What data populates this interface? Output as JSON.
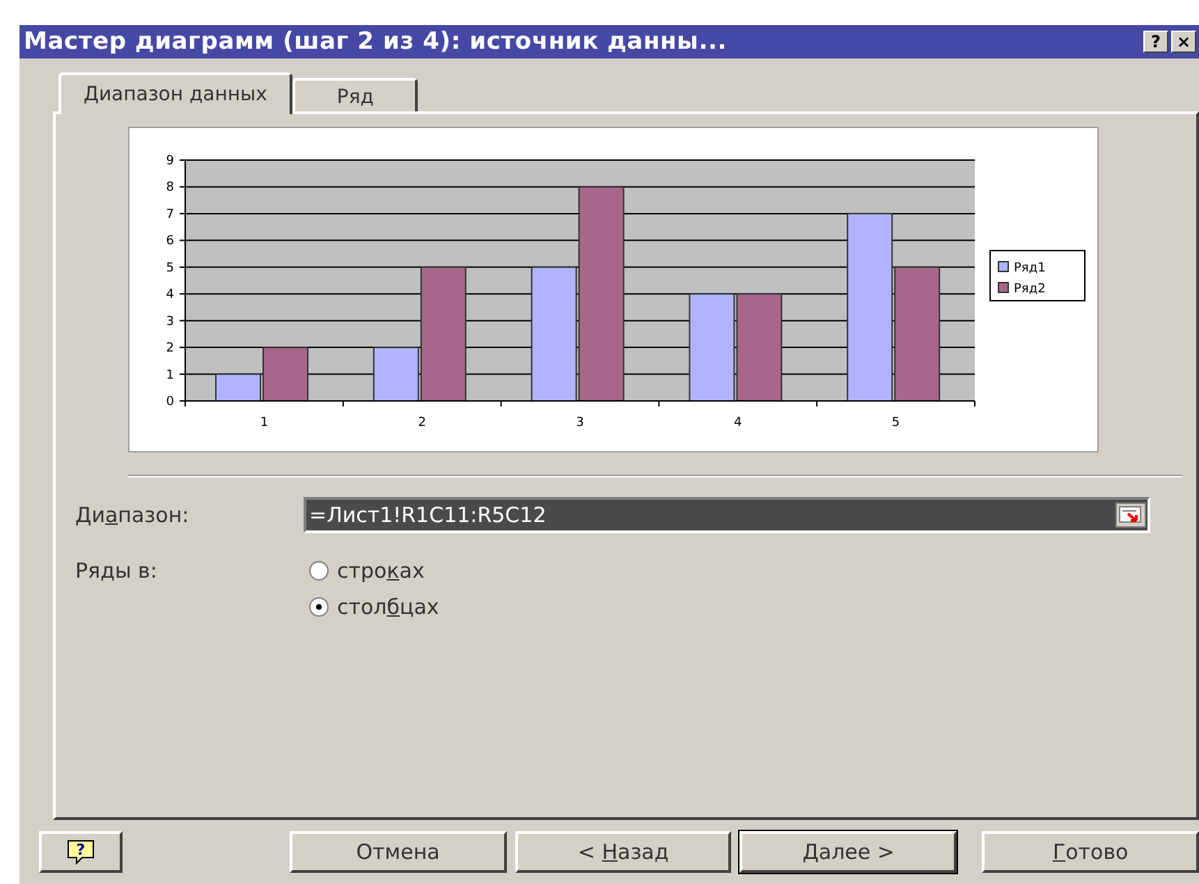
{
  "window": {
    "title": "Мастер диаграмм (шаг 2 из 4): источник данны...",
    "help": "?",
    "close": "×"
  },
  "tabs": [
    {
      "label": "Диапазон данных",
      "selected": true
    },
    {
      "label": "Ряд",
      "selected": false
    }
  ],
  "chart": {
    "chart_data": {
      "type": "bar",
      "grid": true,
      "legend": "right",
      "categories": [
        "1",
        "2",
        "3",
        "4",
        "5"
      ],
      "yticks": [
        0,
        1,
        2,
        3,
        4,
        5,
        6,
        7,
        8,
        9
      ],
      "ylim": [
        0,
        9
      ],
      "series": [
        {
          "name": "Ряд1",
          "color": "#b0b4ff",
          "values": [
            1,
            2,
            5,
            4,
            7
          ]
        },
        {
          "name": "Ряд2",
          "color": "#a8678a",
          "values": [
            2,
            5,
            8,
            4,
            5
          ]
        }
      ]
    }
  },
  "range": {
    "label": [
      "Ди",
      "а",
      "пазон:"
    ],
    "value": "=Лист1!R1C11:R5C12"
  },
  "series_in": {
    "label": "Ряды в:",
    "options": [
      {
        "label": [
          "стро",
          "к",
          "ах"
        ],
        "selected": false
      },
      {
        "label": [
          "стол",
          "б",
          "цах"
        ],
        "selected": true
      }
    ]
  },
  "buttons": [
    {
      "icon": "?",
      "kind": "help"
    },
    {
      "label": {
        "before": "Отмена"
      },
      "kind": "normal"
    },
    {
      "label": {
        "before": "< ",
        "key": "Н",
        "after": "азад"
      },
      "kind": "normal"
    },
    {
      "label": {
        "before": "Далее >"
      },
      "kind": "default"
    },
    {
      "label": {
        "key": "Г",
        "after": "отово"
      },
      "kind": "normal"
    }
  ]
}
